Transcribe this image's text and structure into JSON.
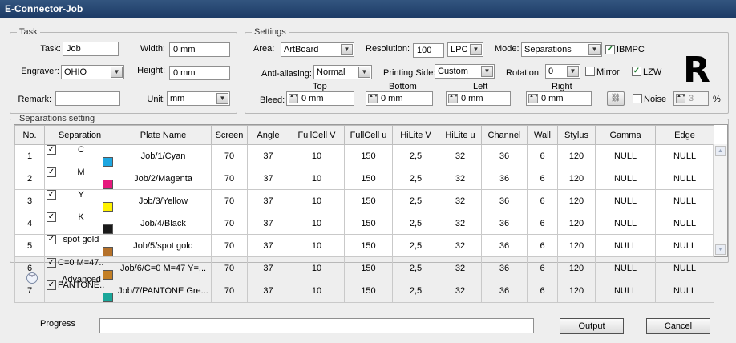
{
  "window": {
    "title": "E-Connector-Job"
  },
  "task": {
    "group_title": "Task",
    "task_label": "Task:",
    "task_value": "Job",
    "width_label": "Width:",
    "width_value": "0 mm",
    "engraver_label": "Engraver:",
    "engraver_value": "OHIO",
    "height_label": "Height:",
    "height_value": "0 mm",
    "remark_label": "Remark:",
    "remark_value": "",
    "unit_label": "Unit:",
    "unit_value": "mm"
  },
  "settings": {
    "group_title": "Settings",
    "area_label": "Area:",
    "area_value": "ArtBoard",
    "resolution_label": "Resolution:",
    "resolution_value": "100",
    "resolution_unit": "LPC",
    "mode_label": "Mode:",
    "mode_value": "Separations",
    "ibmpc_label": "IBMPC",
    "ibmpc_checked": true,
    "antialiasing_label": "Anti-aliasing:",
    "antialiasing_value": "Normal",
    "printing_side_label": "Printing Side:",
    "printing_side_value": "Custom",
    "rotation_label": "Rotation:",
    "rotation_value": "0",
    "mirror_label": "Mirror",
    "mirror_checked": false,
    "lzw_label": "LZW",
    "lzw_checked": true,
    "big_letter": "R",
    "bleed_label": "Bleed:",
    "bleed_top_label": "Top",
    "bleed_top_value": "0 mm",
    "bleed_bottom_label": "Bottom",
    "bleed_bottom_value": "0 mm",
    "bleed_left_label": "Left",
    "bleed_left_value": "0 mm",
    "bleed_right_label": "Right",
    "bleed_right_value": "0 mm",
    "noise_label": "Noise",
    "noise_checked": false,
    "noise_value": "3",
    "noise_unit": "%"
  },
  "separations": {
    "group_title": "Separations setting",
    "columns": [
      "No.",
      "Separation",
      "Plate Name",
      "Screen",
      "Angle",
      "FullCell V",
      "FullCell u",
      "HiLite V",
      "HiLite u",
      "Channel",
      "Wall",
      "Stylus",
      "Gamma",
      "Edge"
    ],
    "rows": [
      {
        "no": "1",
        "checked": true,
        "separation": "C",
        "color": "#1ea7e1",
        "plate": "Job/1/Cyan",
        "screen": "70",
        "angle": "37",
        "fcv": "10",
        "fcu": "150",
        "hlv": "2,5",
        "hlu": "32",
        "channel": "36",
        "wall": "6",
        "stylus": "120",
        "gamma": "NULL",
        "edge": "NULL"
      },
      {
        "no": "2",
        "checked": true,
        "separation": "M",
        "color": "#e6197d",
        "plate": "Job/2/Magenta",
        "screen": "70",
        "angle": "37",
        "fcv": "10",
        "fcu": "150",
        "hlv": "2,5",
        "hlu": "32",
        "channel": "36",
        "wall": "6",
        "stylus": "120",
        "gamma": "NULL",
        "edge": "NULL"
      },
      {
        "no": "3",
        "checked": true,
        "separation": "Y",
        "color": "#fff200",
        "plate": "Job/3/Yellow",
        "screen": "70",
        "angle": "37",
        "fcv": "10",
        "fcu": "150",
        "hlv": "2,5",
        "hlu": "32",
        "channel": "36",
        "wall": "6",
        "stylus": "120",
        "gamma": "NULL",
        "edge": "NULL"
      },
      {
        "no": "4",
        "checked": true,
        "separation": "K",
        "color": "#1a1a1a",
        "plate": "Job/4/Black",
        "screen": "70",
        "angle": "37",
        "fcv": "10",
        "fcu": "150",
        "hlv": "2,5",
        "hlu": "32",
        "channel": "36",
        "wall": "6",
        "stylus": "120",
        "gamma": "NULL",
        "edge": "NULL"
      },
      {
        "no": "5",
        "checked": true,
        "separation": "spot gold",
        "color": "#b5712a",
        "plate": "Job/5/spot gold",
        "screen": "70",
        "angle": "37",
        "fcv": "10",
        "fcu": "150",
        "hlv": "2,5",
        "hlu": "32",
        "channel": "36",
        "wall": "6",
        "stylus": "120",
        "gamma": "NULL",
        "edge": "NULL"
      },
      {
        "no": "6",
        "checked": true,
        "separation": "C=0 M=47...",
        "color": "#c37f25",
        "plate": "Job/6/C=0 M=47 Y=...",
        "screen": "70",
        "angle": "37",
        "fcv": "10",
        "fcu": "150",
        "hlv": "2,5",
        "hlu": "32",
        "channel": "36",
        "wall": "6",
        "stylus": "120",
        "gamma": "NULL",
        "edge": "NULL"
      },
      {
        "no": "7",
        "checked": true,
        "separation": "PANTONE...",
        "color": "#1aa79a",
        "plate": "Job/7/PANTONE Gre...",
        "screen": "70",
        "angle": "37",
        "fcv": "10",
        "fcu": "150",
        "hlv": "2,5",
        "hlu": "32",
        "channel": "36",
        "wall": "6",
        "stylus": "120",
        "gamma": "NULL",
        "edge": "NULL"
      }
    ]
  },
  "advanced": {
    "label": "Advanced"
  },
  "footer": {
    "progress_label": "Progress",
    "progress_fraction": 0,
    "output_label": "Output",
    "cancel_label": "Cancel"
  }
}
